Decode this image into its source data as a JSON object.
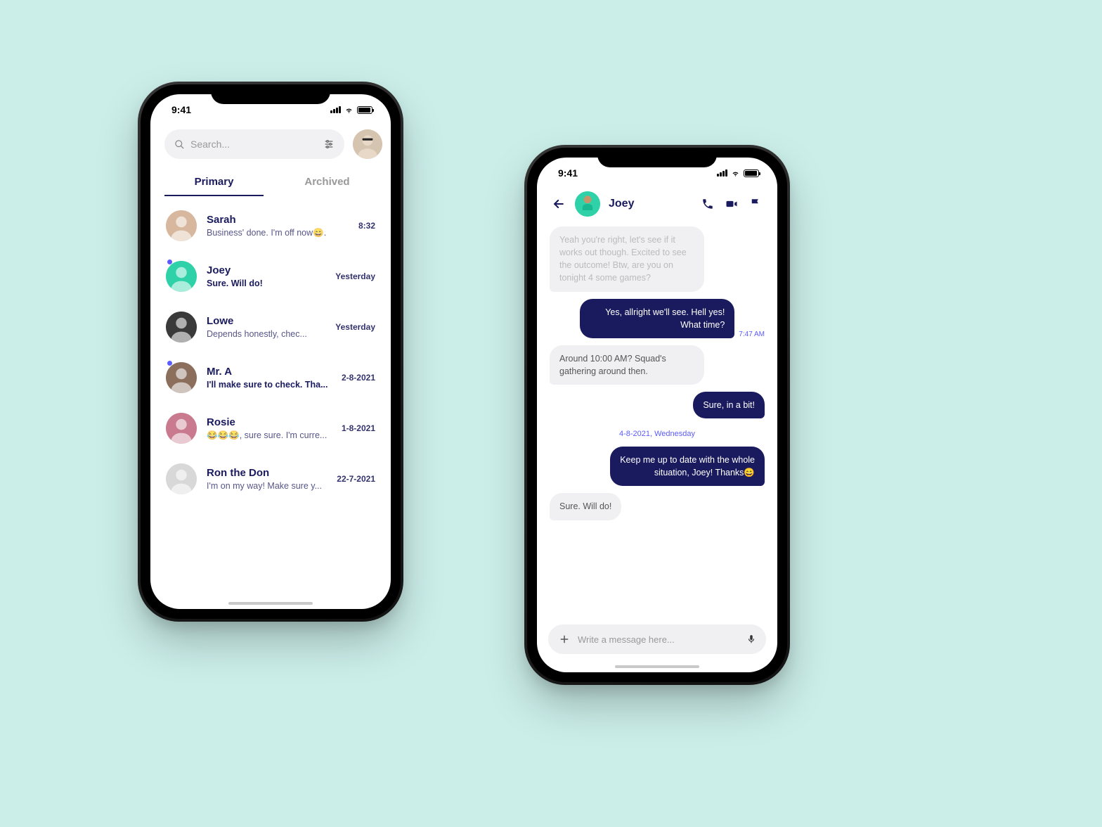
{
  "status": {
    "time": "9:41"
  },
  "left": {
    "search": {
      "placeholder": "Search..."
    },
    "tabs": {
      "primary": "Primary",
      "archived": "Archived"
    },
    "chats": [
      {
        "name": "Sarah",
        "preview": "Business' done. I'm off now😄.",
        "time": "8:32",
        "unread": false,
        "bg": "#d7b89f"
      },
      {
        "name": "Joey",
        "preview": "Sure. Will do!",
        "time": "Yesterday",
        "unread": true,
        "bg": "#2fd2a8"
      },
      {
        "name": "Lowe",
        "preview": "Depends honestly, chec...",
        "time": "Yesterday",
        "unread": false,
        "bg": "#3a3a3a"
      },
      {
        "name": "Mr. A",
        "preview": "I'll make sure to check. Tha...",
        "time": "2-8-2021",
        "unread": true,
        "bg": "#8b6f5c"
      },
      {
        "name": "Rosie",
        "preview": "😂😂😂, sure sure. I'm curre...",
        "time": "1-8-2021",
        "unread": false,
        "bg": "#c97a8e"
      },
      {
        "name": "Ron the Don",
        "preview": "I'm on my way! Make sure y...",
        "time": "22-7-2021",
        "unread": false,
        "bg": "#d8d8d8"
      }
    ]
  },
  "right": {
    "contact": "Joey",
    "messages": [
      {
        "type": "in_faded",
        "text": "Yeah you're right, let's see if it works out though. Excited to see the outcome! Btw, are you on tonight 4 some games?"
      },
      {
        "type": "out_ts",
        "text": "Yes, allright we'll see. Hell yes! What time?",
        "ts": "7:47 AM"
      },
      {
        "type": "in",
        "text": "Around 10:00 AM? Squad's gathering around then."
      },
      {
        "type": "out",
        "text": "Sure, in a bit!"
      },
      {
        "type": "date",
        "text": "4-8-2021, Wednesday"
      },
      {
        "type": "out",
        "text": "Keep me up to date with the whole situation, Joey! Thanks😄"
      },
      {
        "type": "in",
        "text": "Sure. Will do!"
      }
    ],
    "composer": {
      "placeholder": "Write a message here..."
    }
  }
}
